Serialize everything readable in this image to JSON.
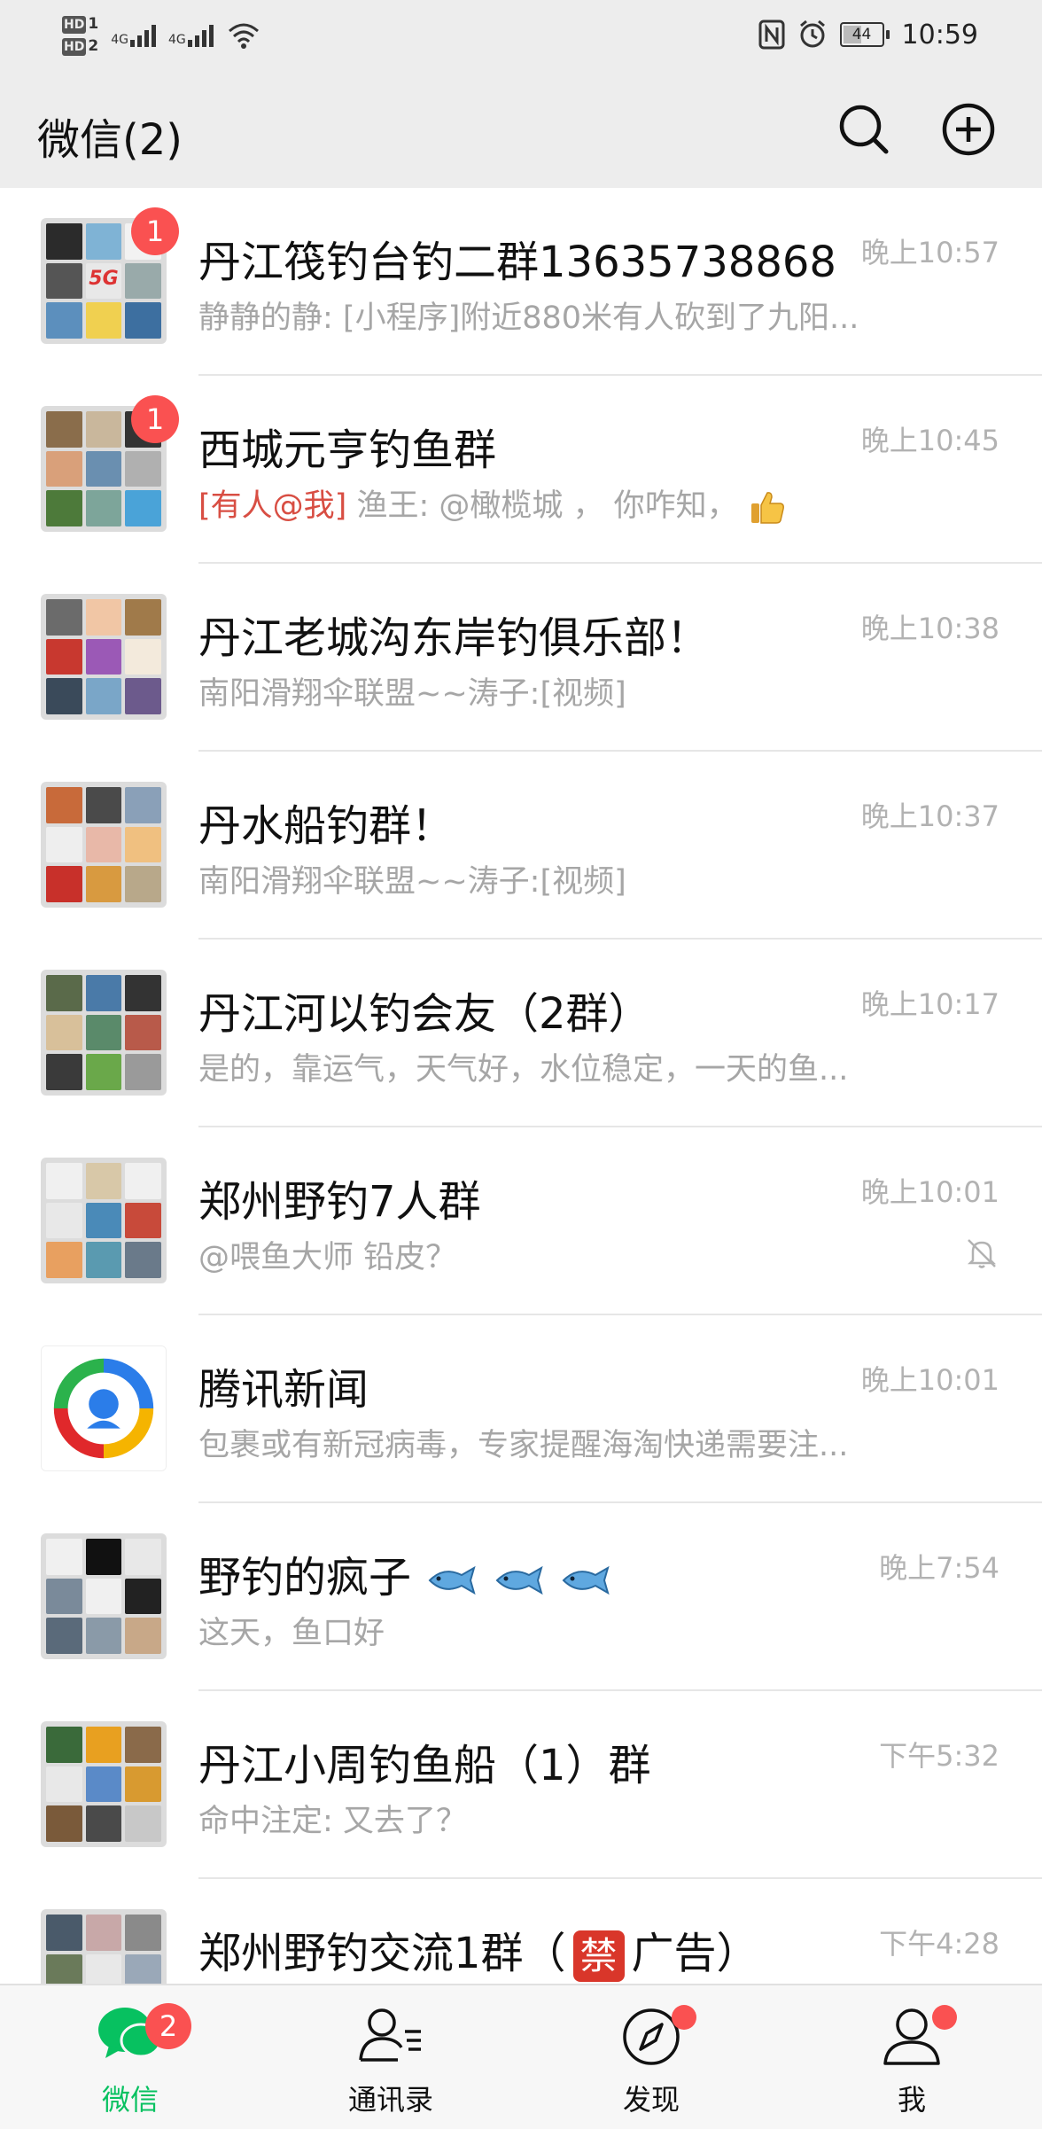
{
  "status_bar": {
    "sim1": "HD",
    "sim2": "HD",
    "net1": "4G",
    "net2": "4G",
    "battery": "44",
    "time": "10:59"
  },
  "header": {
    "title": "微信(2)",
    "search_icon": "search-icon",
    "add_icon": "add-circle-icon"
  },
  "chats": [
    {
      "name": "丹江筏钓台钓二群13635738868",
      "time": "晚上10:57",
      "preview": "静静的静: [小程序]附近880米有人砍到了九阳...",
      "badge": "1"
    },
    {
      "name": "西城元亨钓鱼群",
      "time": "晚上10:45",
      "mention": "[有人@我]",
      "preview": " 渔王: @橄榄城 ， 你咋知，",
      "badge": "1",
      "emoji": "thumbs-up"
    },
    {
      "name": "丹江老城沟东岸钓俱乐部！",
      "time": "晚上10:38",
      "preview": "南阳滑翔伞联盟~~涛子:[视频]"
    },
    {
      "name": "丹水船钓群！",
      "time": "晚上10:37",
      "preview": "南阳滑翔伞联盟~~涛子:[视频]"
    },
    {
      "name": "丹江河以钓会友（2群）",
      "time": "晚上10:17",
      "preview": "是的，靠运气，天气好，水位稳定，一天的鱼..."
    },
    {
      "name": "郑州野钓7人群",
      "time": "晚上10:01",
      "preview": "@喂鱼大师 铅皮？",
      "muted": true
    },
    {
      "name": "腾讯新闻",
      "time": "晚上10:01",
      "preview": "包裹或有新冠病毒，专家提醒海淘快递需要注..."
    },
    {
      "name": "野钓的疯子",
      "time": "晚上7:54",
      "preview": "这天，鱼口好",
      "emoji": "fish x3"
    },
    {
      "name": "丹江小周钓鱼船（1）群",
      "time": "下午5:32",
      "preview": "命中注定: 又去了？"
    },
    {
      "name_a": "郑州野钓交流1群（",
      "ban_char": "禁",
      "name_b": "广告）",
      "time": "下午4:28",
      "preview": ""
    }
  ],
  "tabs": [
    {
      "label": "微信",
      "icon": "chat-bubble-icon",
      "badge": "2",
      "active": true
    },
    {
      "label": "通讯录",
      "icon": "contacts-icon"
    },
    {
      "label": "发现",
      "icon": "compass-icon",
      "dot": true
    },
    {
      "label": "我",
      "icon": "person-icon",
      "dot": true
    }
  ],
  "colors": {
    "accent": "#07c160",
    "badge": "#fa5151",
    "mention": "#d84e43",
    "header_bg": "#ededed"
  }
}
